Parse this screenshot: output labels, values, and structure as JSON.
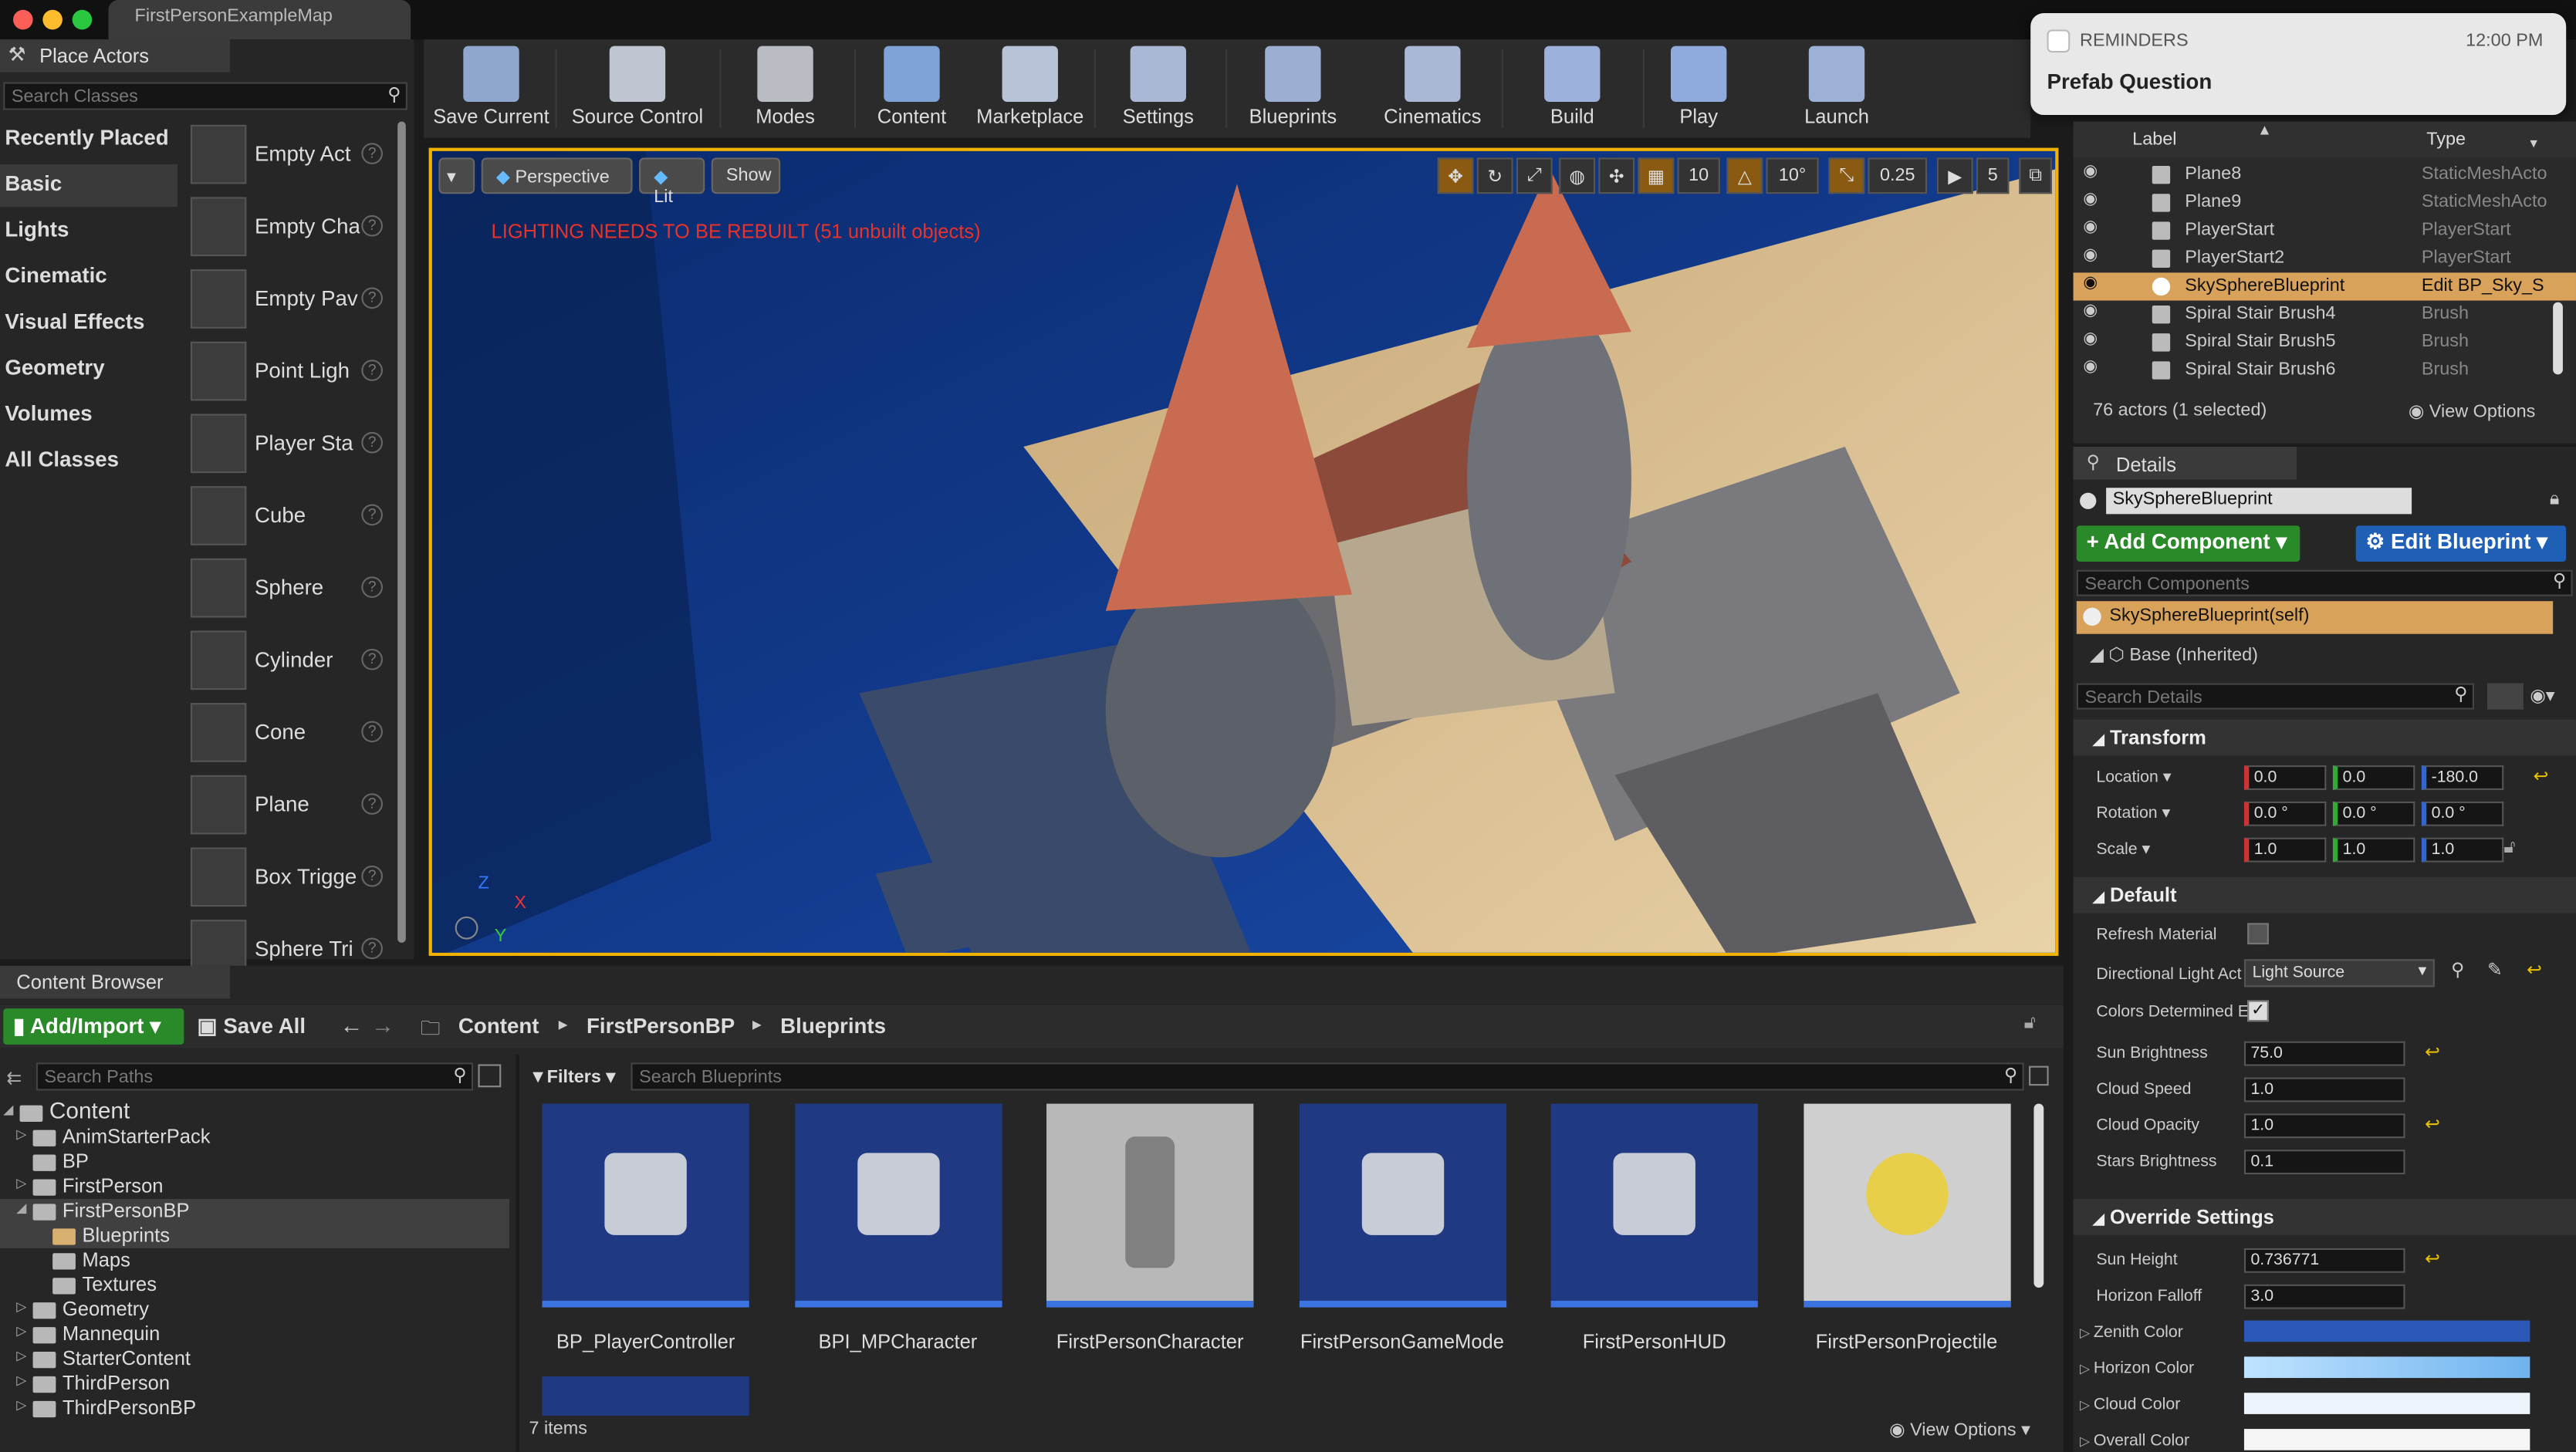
{
  "window": {
    "tab_title": "FirstPersonExampleMap"
  },
  "place_actors": {
    "tab_label": "Place Actors",
    "search_placeholder": "Search Classes",
    "categories": [
      "Recently Placed",
      "Basic",
      "Lights",
      "Cinematic",
      "Visual Effects",
      "Geometry",
      "Volumes",
      "All Classes"
    ],
    "selected_category": "Basic",
    "items": [
      "Empty Act",
      "Empty Cha",
      "Empty Pav",
      "Point Ligh",
      "Player Sta",
      "Cube",
      "Sphere",
      "Cylinder",
      "Cone",
      "Plane",
      "Box Trigge",
      "Sphere Tri"
    ]
  },
  "toolbar": {
    "buttons": [
      "Save Current",
      "Source Control",
      "Modes",
      "Content",
      "Marketplace",
      "Settings",
      "Blueprints",
      "Cinematics",
      "Build",
      "Play",
      "Launch"
    ]
  },
  "viewport": {
    "perspective_label": "Perspective",
    "lit_label": "Lit",
    "show_label": "Show",
    "warning": "LIGHTING NEEDS TO BE REBUILT (51 unbuilt objects)",
    "grid_snap": "10",
    "rotation_snap": "10°",
    "scale_snap": "0.25",
    "camera_speed": "5",
    "axis_x": "X",
    "axis_y": "Y",
    "axis_z": "Z"
  },
  "notification": {
    "app": "REMINDERS",
    "time": "12:00 PM",
    "title": "Prefab Question"
  },
  "world_outliner": {
    "col_label": "Label",
    "col_type": "Type",
    "rows": [
      {
        "label": "Plane8",
        "type": "StaticMeshActo"
      },
      {
        "label": "Plane9",
        "type": "StaticMeshActo"
      },
      {
        "label": "PlayerStart",
        "type": "PlayerStart"
      },
      {
        "label": "PlayerStart2",
        "type": "PlayerStart"
      },
      {
        "label": "SkySphereBlueprint",
        "type": "Edit BP_Sky_S"
      },
      {
        "label": "Spiral Stair Brush4",
        "type": "Brush"
      },
      {
        "label": "Spiral Stair Brush5",
        "type": "Brush"
      },
      {
        "label": "Spiral Stair Brush6",
        "type": "Brush"
      }
    ],
    "selected_index": 4,
    "summary": "76 actors (1 selected)",
    "view_options": "View Options"
  },
  "details": {
    "tab_label": "Details",
    "object_name": "SkySphereBlueprint",
    "add_component": "Add Component",
    "edit_blueprint": "Edit Blueprint",
    "search_components": "Search Components",
    "component_self": "SkySphereBlueprint(self)",
    "component_base": "Base (Inherited)",
    "search_details": "Search Details",
    "transform": {
      "title": "Transform",
      "location_label": "Location",
      "rotation_label": "Rotation",
      "scale_label": "Scale",
      "location": [
        "0.0",
        "0.0",
        "-180.0"
      ],
      "rotation": [
        "0.0 °",
        "0.0 °",
        "0.0 °"
      ],
      "scale": [
        "1.0",
        "1.0",
        "1.0"
      ]
    },
    "default": {
      "title": "Default",
      "refresh_material": "Refresh Material",
      "directional_light": "Directional Light Act",
      "directional_light_value": "Light Source",
      "colors_determined": "Colors Determined E",
      "sun_brightness": "Sun Brightness",
      "sun_brightness_value": "75.0",
      "cloud_speed": "Cloud Speed",
      "cloud_speed_value": "1.0",
      "cloud_opacity": "Cloud Opacity",
      "cloud_opacity_value": "1.0",
      "stars_brightness": "Stars Brightness",
      "stars_brightness_value": "0.1"
    },
    "override": {
      "title": "Override Settings",
      "sun_height": "Sun Height",
      "sun_height_value": "0.736771",
      "horizon_falloff": "Horizon Falloff",
      "horizon_falloff_value": "3.0",
      "zenith_color": "Zenith Color",
      "horizon_color": "Horizon Color",
      "cloud_color": "Cloud Color",
      "overall_color": "Overall Color"
    }
  },
  "content_browser": {
    "tab_label": "Content Browser",
    "add_import": "Add/Import",
    "save_all": "Save All",
    "breadcrumb": [
      "Content",
      "FirstPersonBP",
      "Blueprints"
    ],
    "search_paths": "Search Paths",
    "filters": "Filters",
    "search_blueprints": "Search Blueprints",
    "tree": [
      {
        "name": "Content",
        "depth": 0
      },
      {
        "name": "AnimStarterPack",
        "depth": 1
      },
      {
        "name": "BP",
        "depth": 1
      },
      {
        "name": "FirstPerson",
        "depth": 1
      },
      {
        "name": "FirstPersonBP",
        "depth": 1
      },
      {
        "name": "Blueprints",
        "depth": 2
      },
      {
        "name": "Maps",
        "depth": 2
      },
      {
        "name": "Textures",
        "depth": 2
      },
      {
        "name": "Geometry",
        "depth": 1
      },
      {
        "name": "Mannequin",
        "depth": 1
      },
      {
        "name": "StarterContent",
        "depth": 1
      },
      {
        "name": "ThirdPerson",
        "depth": 1
      },
      {
        "name": "ThirdPersonBP",
        "depth": 1
      }
    ],
    "assets": [
      "BP_PlayerController",
      "BPI_MPCharacter",
      "FirstPersonCharacter",
      "FirstPersonGameMode",
      "FirstPersonHUD",
      "FirstPersonProjectile"
    ],
    "item_count": "7 items",
    "view_options": "View Options"
  }
}
